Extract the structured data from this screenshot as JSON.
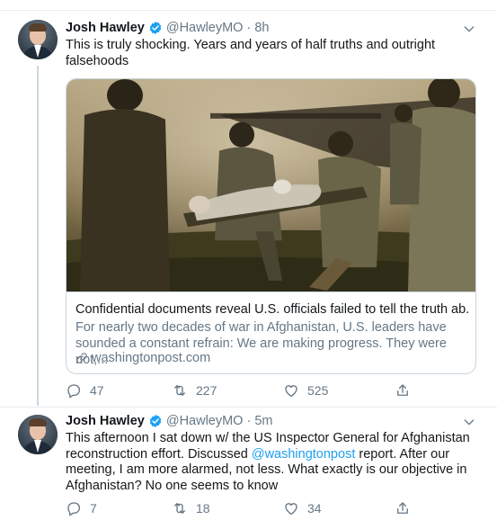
{
  "tweets": [
    {
      "author": "Josh Hawley",
      "handle": "@HawleyMO",
      "separator": "·",
      "time": "8h",
      "text": "This is truly shocking. Years and years of half truths and outright falsehoods",
      "card": {
        "title": "Confidential documents reveal U.S. officials failed to tell the truth ab...",
        "description": "For nearly two decades of war in Afghanistan, U.S. leaders have sounded a constant refrain: We are making progress. They were not,...",
        "domain": "washingtonpost.com"
      },
      "replies": "47",
      "retweets": "227",
      "likes": "525"
    },
    {
      "author": "Josh Hawley",
      "handle": "@HawleyMO",
      "separator": "·",
      "time": "5m",
      "text_before": "This afternoon I sat down w/ the US Inspector General for Afghanistan reconstruction effort. Discussed ",
      "mention": "@washingtonpost",
      "text_after": " report. After our meeting, I am more alarmed, not less. What exactly is our objective in Afghanistan? No one seems to know",
      "replies": "7",
      "retweets": "18",
      "likes": "34"
    }
  ],
  "colors": {
    "accent": "#1da1f2",
    "secondary": "#657786",
    "border": "#ccd6dd"
  },
  "icons": [
    "verified-badge-icon",
    "chevron-down-icon",
    "reply-icon",
    "retweet-icon",
    "like-icon",
    "share-icon",
    "link-icon"
  ]
}
